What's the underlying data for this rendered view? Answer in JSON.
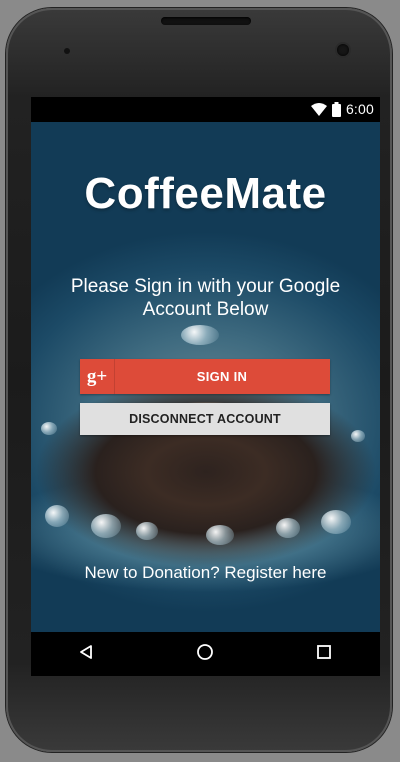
{
  "status_bar": {
    "time": "6:00",
    "wifi_icon": "wifi-icon",
    "battery_icon": "battery-icon"
  },
  "app": {
    "title": "CoffeeMate",
    "prompt": "Please Sign in with your Google Account Below",
    "signin": {
      "icon_label": "g+",
      "label": "SIGN IN",
      "color": "#dd4b39"
    },
    "disconnect": {
      "label": "DISCONNECT ACCOUNT",
      "color": "#e0e0e0"
    },
    "register_text": "New to Donation? Register here"
  },
  "nav_bar": {
    "back_icon": "back-triangle-icon",
    "home_icon": "home-circle-icon",
    "recents_icon": "recents-square-icon"
  }
}
